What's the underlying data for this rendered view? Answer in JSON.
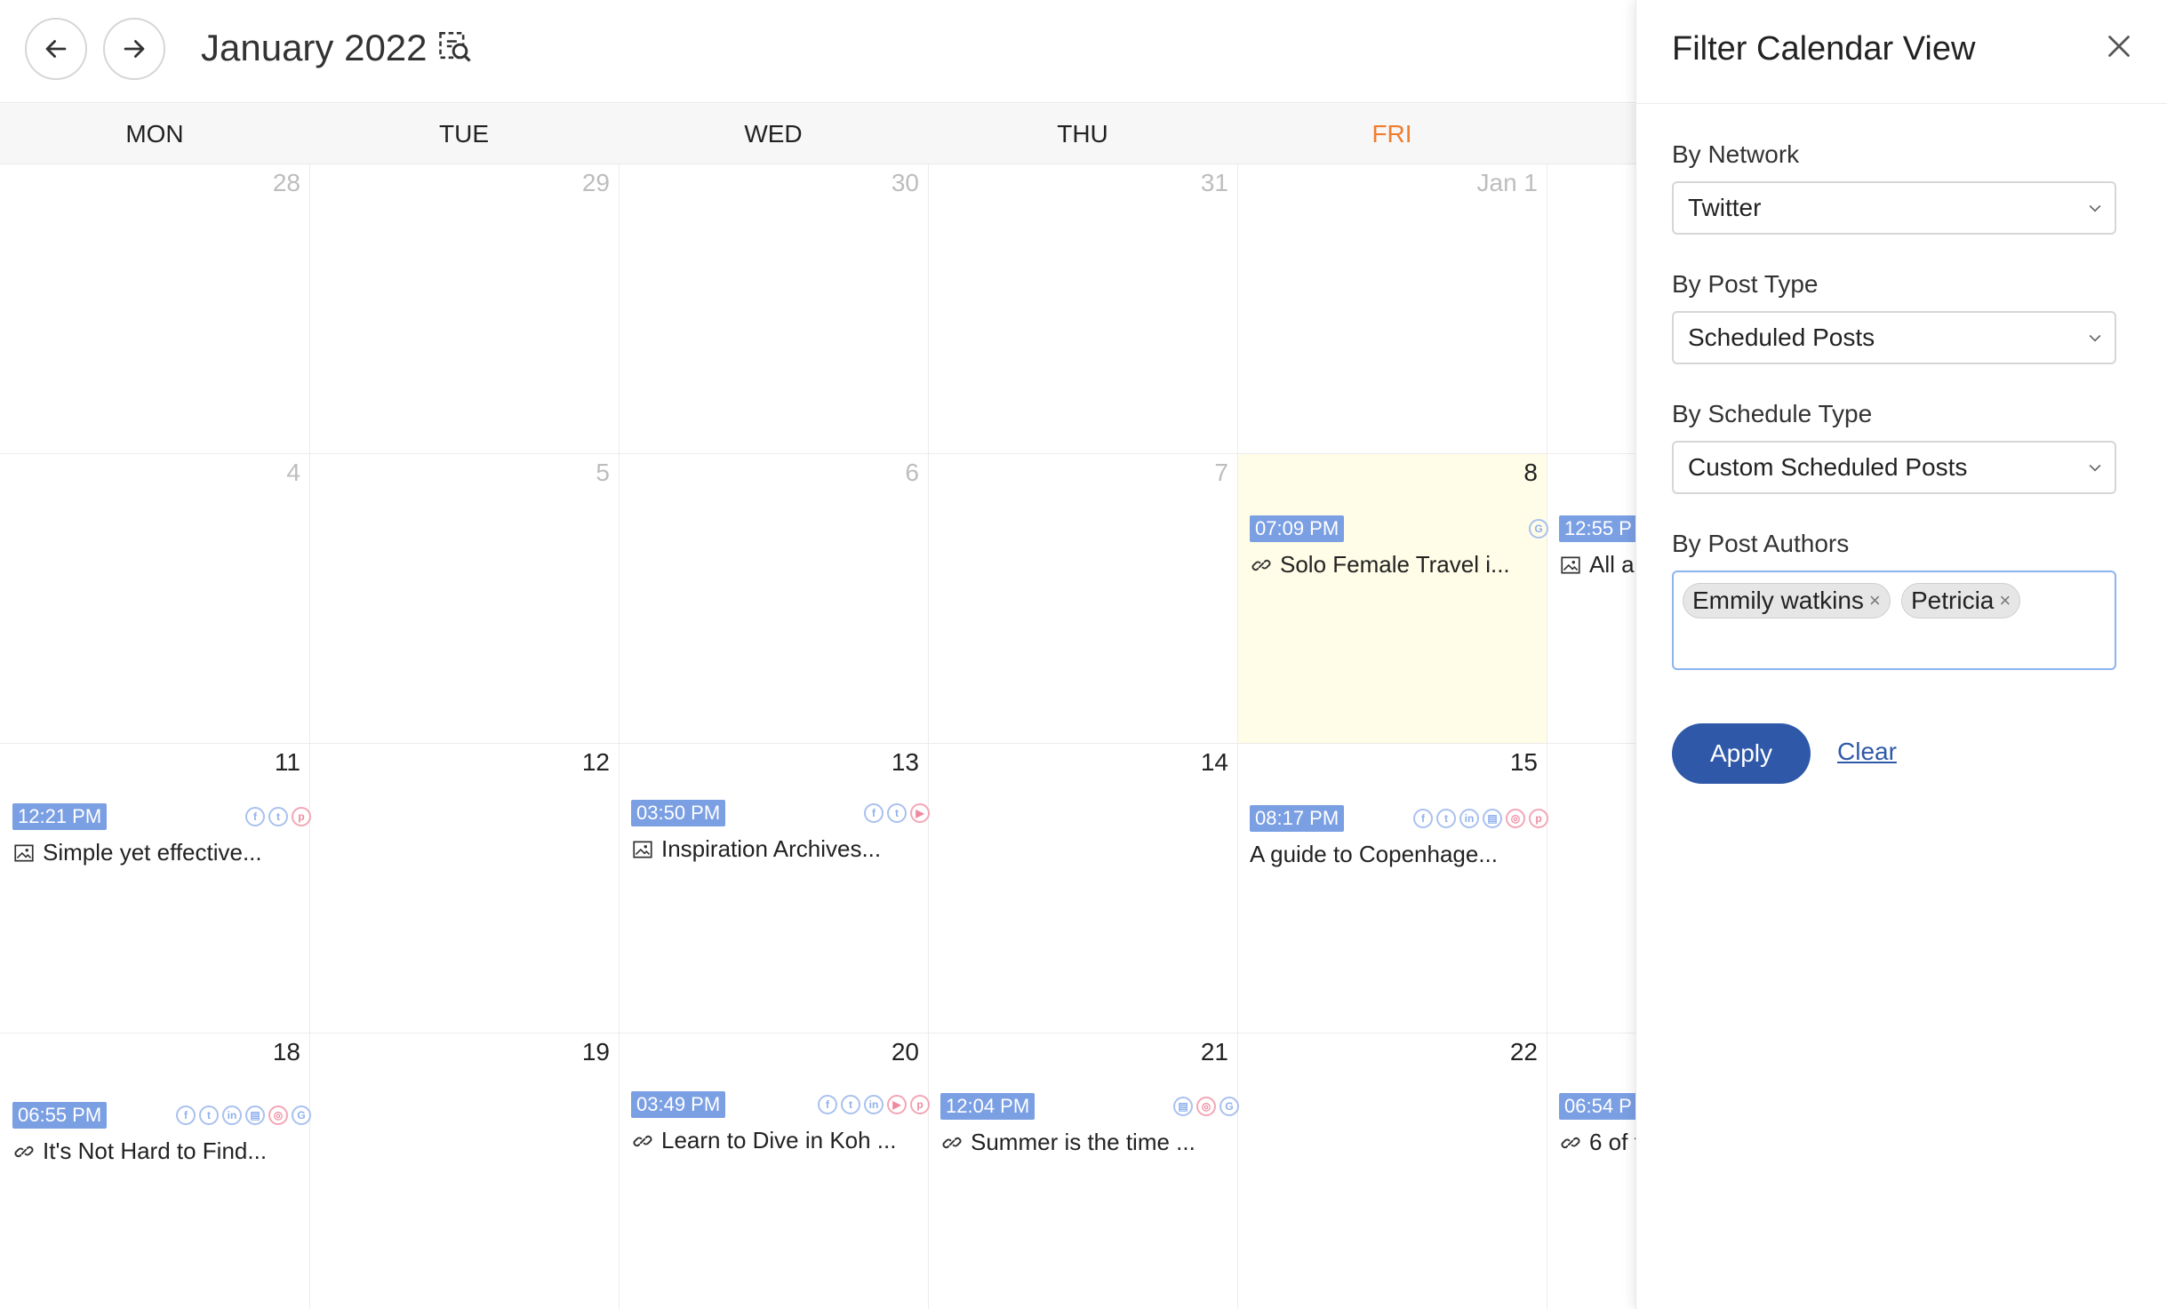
{
  "header": {
    "title": "January 2022",
    "prev_label": "previous-month",
    "next_label": "next-month"
  },
  "days": [
    "MON",
    "TUE",
    "WED",
    "THU",
    "FRI"
  ],
  "today_color": "#f07d2e",
  "weeks": [
    [
      "28",
      "29",
      "30",
      "31",
      "Jan 1"
    ],
    [
      "4",
      "5",
      "6",
      "7",
      "8"
    ],
    [
      "11",
      "12",
      "13",
      "14",
      "15"
    ],
    [
      "18",
      "19",
      "20",
      "21",
      "22"
    ]
  ],
  "events": {
    "jan8": {
      "time": "07:09 PM",
      "title": "Solo Female Travel i...",
      "icons": [
        "google"
      ]
    },
    "jan9": {
      "time": "12:55 P",
      "title": "All a"
    },
    "jan11": {
      "time": "12:21 PM",
      "title": "Simple yet effective...",
      "icons": [
        "facebook",
        "twitter",
        "pinterest"
      ]
    },
    "jan13": {
      "time": "03:50 PM",
      "title": "Inspiration Archives...",
      "icons": [
        "facebook",
        "twitter",
        "youtube"
      ]
    },
    "jan15": {
      "time": "08:17 PM",
      "title": "A guide to Copenhage...",
      "icons": [
        "facebook",
        "twitter",
        "linkedin",
        "google-business",
        "instagram",
        "pinterest"
      ]
    },
    "jan18": {
      "time": "06:55 PM",
      "title": "It's Not Hard to Find...",
      "icons": [
        "facebook",
        "twitter",
        "linkedin",
        "google-business",
        "instagram",
        "google"
      ]
    },
    "jan20": {
      "time": "03:49 PM",
      "title": "Learn to Dive in Koh ...",
      "icons": [
        "facebook",
        "twitter",
        "linkedin",
        "youtube",
        "pinterest"
      ]
    },
    "jan21": {
      "time": "12:04 PM",
      "title": "Summer is the time ...",
      "icons": [
        "google-business",
        "instagram",
        "google"
      ]
    },
    "jan23": {
      "time": "06:54 P",
      "title": "6 of t"
    }
  },
  "panel": {
    "title": "Filter Calendar View",
    "network_label": "By Network",
    "network_value": "Twitter",
    "posttype_label": "By Post Type",
    "posttype_value": "Scheduled Posts",
    "schedtype_label": "By Schedule Type",
    "schedtype_value": "Custom Scheduled Posts",
    "authors_label": "By Post Authors",
    "authors": [
      "Emmily watkins",
      "Petricia"
    ],
    "apply_label": "Apply",
    "clear_label": "Clear"
  },
  "colors": {
    "accent": "#2f59a8",
    "badge": "#7b9fe3",
    "highlight": "#fffde7"
  }
}
